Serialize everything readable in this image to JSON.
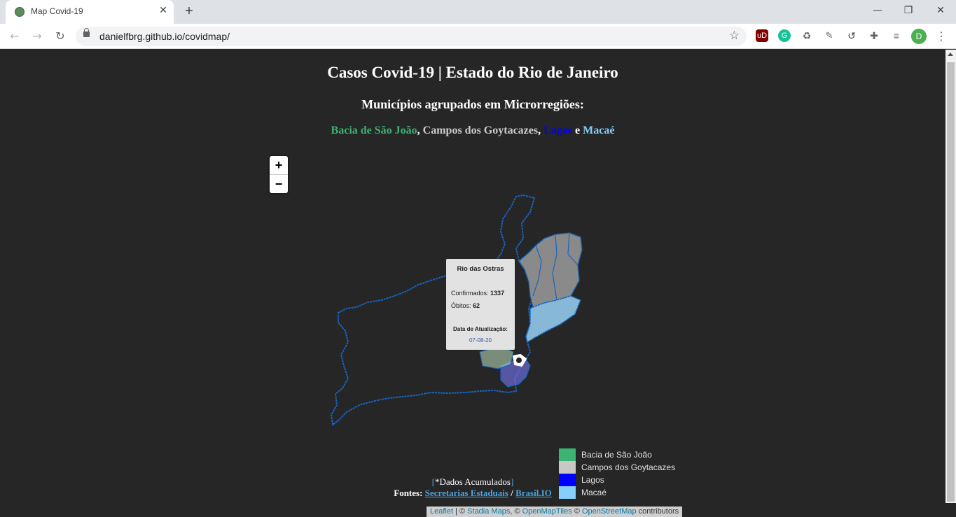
{
  "browser": {
    "tab_title": "Map Covid-19",
    "tab_close": "✕",
    "new_tab": "+",
    "url": "danielfbrg.github.io/covidmap/",
    "profile_initial": "D",
    "extensions": [
      "uBlock",
      "Grammarly",
      "Recycle",
      "Notes",
      "Sync",
      "Extensions",
      "Media"
    ]
  },
  "page": {
    "title": "Casos Covid-19 | Estado do Rio de Janeiro",
    "subtitle": "Municípios agrupados em Microrregiões:",
    "regions": [
      {
        "name": "Bacia de São João",
        "color": "#3cb371"
      },
      {
        "name": "Campos dos Goytacazes",
        "color": "#cccccc"
      },
      {
        "name": "Lagos",
        "color": "#0000ff"
      },
      {
        "name": "Macaé",
        "color": "#87cefa"
      }
    ],
    "sep1": ", ",
    "sep2": ", ",
    "sep3": " e "
  },
  "map": {
    "zoom_in": "+",
    "zoom_out": "−",
    "outline_color": "#1565c0",
    "popup": {
      "municipio": "Rio das Ostras",
      "confirmados_label": "Confirmados:",
      "confirmados": "1337",
      "obitos_label": "Óbitos:",
      "obitos": "62",
      "data_label": "Data de Atualização:",
      "data": "07-08-20"
    },
    "legend": [
      {
        "label": "Bacia de São João",
        "color": "#3cb371"
      },
      {
        "label": "Campos dos Goytacazes",
        "color": "#c8c8c8"
      },
      {
        "label": "Lagos",
        "color": "#0000ff"
      },
      {
        "label": "Macaé",
        "color": "#87cefa"
      }
    ],
    "attribution": {
      "leaflet": "Leaflet",
      "sep": " | © ",
      "stadia": "Stadia Maps",
      "c2": ", © ",
      "omt": "OpenMapTiles",
      "c3": " © ",
      "osm": "OpenStreetMap",
      "tail": " contributors"
    }
  },
  "footer": {
    "open_bracket": "[",
    "dados": "*Dados Acumulados",
    "close_bracket": "]",
    "fontes": "Fontes: ",
    "fonte1": "Secretarias Estaduais",
    "slash": " / ",
    "fonte2": "Brasil.IO"
  }
}
